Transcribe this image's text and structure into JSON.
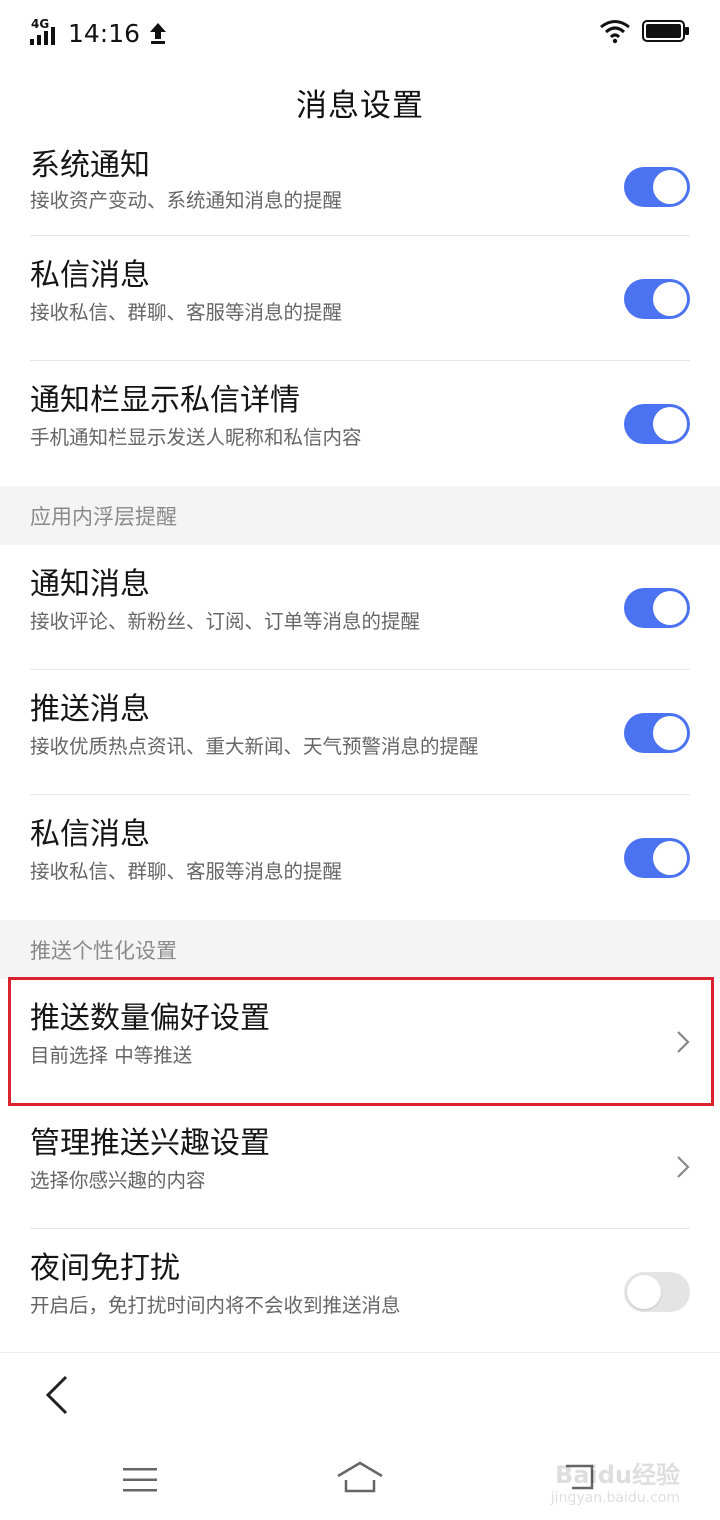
{
  "status_bar": {
    "network": "4G",
    "time": "14:16",
    "upload_icon": "upload-arrow-icon",
    "wifi_icon": "wifi-icon",
    "battery_icon": "battery-icon"
  },
  "header": {
    "title": "消息设置"
  },
  "settings": [
    {
      "type": "toggle",
      "title": "系统通知",
      "desc": "接收资产变动、系统通知消息的提醒",
      "on": true
    },
    {
      "type": "toggle",
      "title": "私信消息",
      "desc": "接收私信、群聊、客服等消息的提醒",
      "on": true
    },
    {
      "type": "toggle",
      "title": "通知栏显示私信详情",
      "desc": "手机通知栏显示发送人昵称和私信内容",
      "on": true
    },
    {
      "type": "section",
      "label": "应用内浮层提醒"
    },
    {
      "type": "toggle",
      "title": "通知消息",
      "desc": "接收评论、新粉丝、订阅、订单等消息的提醒",
      "on": true
    },
    {
      "type": "toggle",
      "title": "推送消息",
      "desc": "接收优质热点资讯、重大新闻、天气预警消息的提醒",
      "on": true
    },
    {
      "type": "toggle",
      "title": "私信消息",
      "desc": "接收私信、群聊、客服等消息的提醒",
      "on": true
    },
    {
      "type": "section",
      "label": "推送个性化设置"
    },
    {
      "type": "link",
      "title": "推送数量偏好设置",
      "desc": "目前选择 中等推送"
    },
    {
      "type": "link",
      "title": "管理推送兴趣设置",
      "desc": "选择你感兴趣的内容"
    },
    {
      "type": "toggle",
      "title": "夜间免打扰",
      "desc": "开启后，免打扰时间内将不会收到推送消息",
      "on": false
    }
  ],
  "colors": {
    "toggle_on": "#4b72f0",
    "toggle_off": "#e4e4e4",
    "highlight": "#d9232e",
    "section_bg": "#f4f4f4"
  },
  "bottom": {
    "back_icon": "back-chevron-icon",
    "menu_icon": "menu-icon",
    "home_icon": "home-icon",
    "return_icon": "return-icon"
  },
  "watermark": {
    "logo": "Baidu经验",
    "url": "jingyan.baidu.com"
  }
}
